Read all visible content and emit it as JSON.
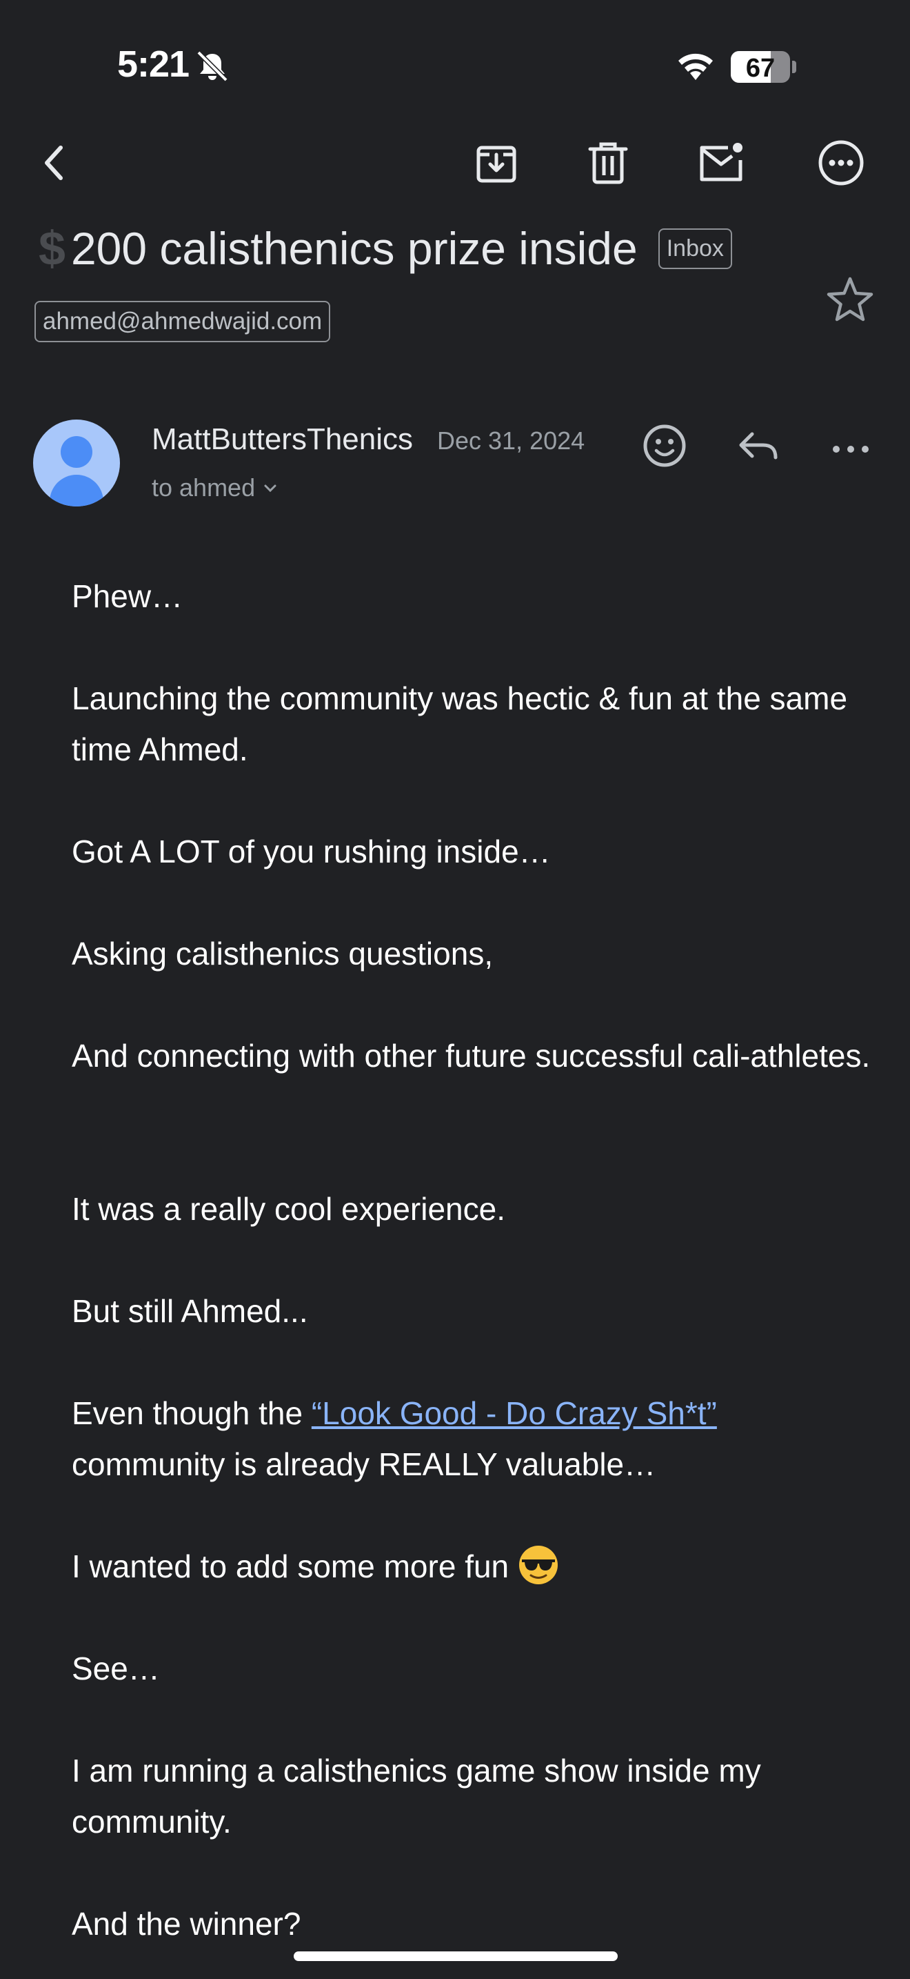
{
  "status_bar": {
    "time": "5:21",
    "battery_percent": "67",
    "battery_level": 0.67,
    "icons": [
      "bell-slash-icon",
      "wifi-icon",
      "battery-icon"
    ]
  },
  "toolbar": {
    "icons": [
      "back-arrow-icon",
      "archive-icon",
      "trash-icon",
      "mark-unread-icon",
      "more-horizontal-circle-icon"
    ]
  },
  "email": {
    "subject_prefix": "$",
    "subject": "200 calisthenics prize inside",
    "label": "Inbox",
    "recipient_address": "ahmed@ahmedwajid.com",
    "sender": "MattButtersThenics",
    "date": "Dec 31, 2024",
    "to_line": "to ahmed",
    "body": {
      "p1": "Phew…",
      "p2": "Launching the community was hectic & fun at the same time Ahmed.",
      "p3": "Got A LOT of you rushing inside…",
      "p4": "Asking calisthenics questions,",
      "p5": "And connecting with other future successful cali-athletes.",
      "p6": "It was a really cool experience.",
      "p7": "But still Ahmed...",
      "p8_before": "Even though the ",
      "p8_link": "“Look Good - Do Crazy Sh*t”",
      "p8_after": " community is already REALLY valuable…",
      "p9": "I wanted to add some more fun ",
      "p10": "See…",
      "p11": "I am running a calisthenics game show inside my community.",
      "p12": "And the winner?"
    }
  },
  "colors": {
    "background": "#202124",
    "text": "#ffffff",
    "secondary_text": "#9aa0a6",
    "link": "#8ab4f8",
    "avatar_bg": "#a8c7fa",
    "avatar_fg": "#4c8df6"
  }
}
